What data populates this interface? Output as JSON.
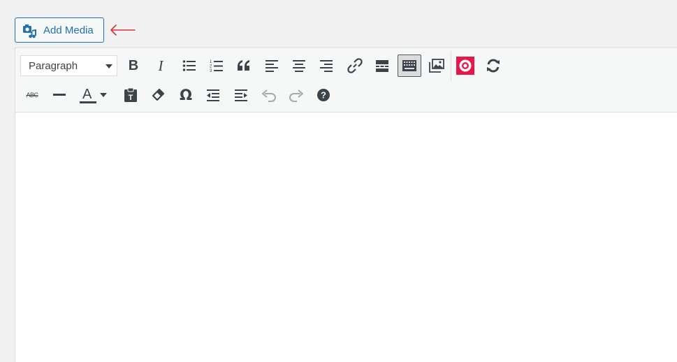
{
  "add_media": {
    "label": "Add Media"
  },
  "toolbar": {
    "format_select": {
      "value": "Paragraph"
    },
    "row1": [
      "bold-icon",
      "italic-icon",
      "bulleted-list-icon",
      "numbered-list-icon",
      "blockquote-icon",
      "align-left-icon",
      "align-center-icon",
      "align-right-icon",
      "link-icon",
      "read-more-icon",
      "toolbar-toggle-icon",
      "gallery-icon",
      "plugin-target-icon",
      "refresh-icon"
    ],
    "row2": [
      "strikethrough-icon",
      "horizontal-line-icon",
      "text-color-icon",
      "paste-as-text-icon",
      "clear-formatting-icon",
      "special-character-icon",
      "outdent-icon",
      "indent-icon",
      "undo-icon",
      "redo-icon",
      "help-icon"
    ],
    "italic_glyph": "I",
    "bold_glyph": "B",
    "omega_glyph": "Ω",
    "text_color_glyph": "A",
    "strike_glyph": "ABC"
  },
  "colors": {
    "accent": "#2271b1",
    "arrow": "#d63638",
    "icon": "#3c434a",
    "disabled": "#a7aaad"
  }
}
